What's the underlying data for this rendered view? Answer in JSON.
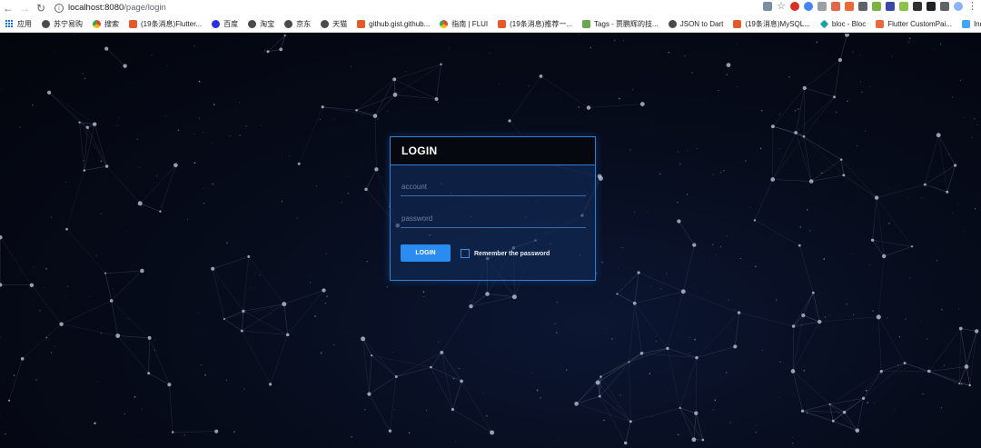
{
  "browser": {
    "url_host": "localhost:8080",
    "url_path": "/page/login",
    "bookmarks": [
      {
        "label": "应用",
        "icon": "apps-icon"
      },
      {
        "label": "苏宁易购",
        "icon": "globe-icon"
      },
      {
        "label": "搜索",
        "icon": "chrome-icon"
      },
      {
        "label": "(19条消息)Flutter...",
        "icon": "csdn-icon"
      },
      {
        "label": "百度",
        "icon": "baidu-icon"
      },
      {
        "label": "淘宝",
        "icon": "globe-icon"
      },
      {
        "label": "京东",
        "icon": "globe-icon"
      },
      {
        "label": "天猫",
        "icon": "globe-icon"
      },
      {
        "label": "github.gist.github...",
        "icon": "csdn-icon"
      },
      {
        "label": "指南 | FLUI",
        "icon": "chrome-icon"
      },
      {
        "label": "(19条消息)推荐一...",
        "icon": "csdn-icon"
      },
      {
        "label": "Tags - 贾鹏辉的技...",
        "icon": "tags-icon"
      },
      {
        "label": "JSON to Dart",
        "icon": "globe-icon"
      },
      {
        "label": "(19条消息)MySQL...",
        "icon": "csdn-icon"
      },
      {
        "label": "bloc - Bloc",
        "icon": "bloc-icon"
      },
      {
        "label": "Flutter CustomPai...",
        "icon": "flutter-icon"
      },
      {
        "label": "Index of /flutter/fl...",
        "icon": "flutter-blue-icon"
      }
    ],
    "more_label": "»"
  },
  "login": {
    "title": "LOGIN",
    "account_placeholder": "account",
    "account_value": "",
    "password_placeholder": "password",
    "password_value": "",
    "button_label": "LOGIN",
    "remember_label": "Remember the password",
    "remember_checked": false
  },
  "colors": {
    "accent": "#2a8cf0",
    "card_border": "#2f7fd6",
    "background": "#05070f"
  }
}
